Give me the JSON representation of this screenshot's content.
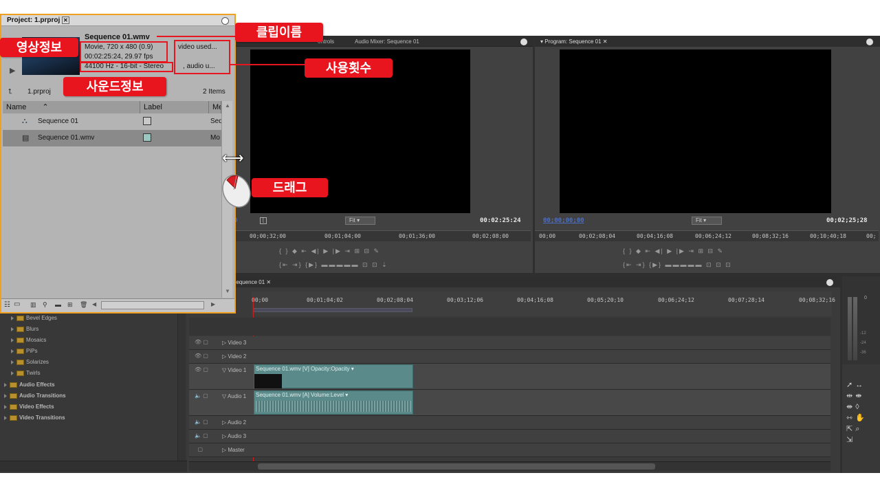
{
  "project_panel": {
    "tab_title": "Project: 1.prproj",
    "clip_name": "Sequence 01.wmv",
    "video_info_line1": "Movie, 720 x 480 (0.9)",
    "video_info_line2": "00:02:25:24, 29.97 fps",
    "audio_info": "44100 Hz - 16-bit - Stereo",
    "usage_video": "video used...",
    "usage_audio": ", audio u...",
    "bin_name": "1.prproj",
    "item_count": "2 Items",
    "columns": [
      "Name",
      "Label",
      "Me"
    ],
    "items": [
      {
        "name": "Sequence 01",
        "media": "Seq"
      },
      {
        "name": "Sequence 01.wmv",
        "media": "Mo"
      }
    ]
  },
  "source_monitor": {
    "tabs": [
      "ontrols",
      "Audio Mixer: Sequence 01"
    ],
    "timecode_left": "0",
    "fit_label": "Fit",
    "duration": "00:02:25:24",
    "ruler": [
      "00;00;32;00",
      "00;01;04;00",
      "00;01;36;00",
      "00;02;08;00"
    ]
  },
  "program_monitor": {
    "tab": "Program: Sequence 01",
    "timecode": "00;00;00;00",
    "fit_label": "Fit",
    "duration": "00;02;25;28",
    "ruler": [
      "00;00",
      "00;02;08;04",
      "00;04;16;08",
      "00;06;24;12",
      "00;08;32;16",
      "00;10;40;18",
      "00;"
    ]
  },
  "timeline": {
    "tab": "Sequence 01",
    "ruler": [
      "00;00",
      "00;01;04;02",
      "00;02;08;04",
      "00;03;12;06",
      "00;04;16;08",
      "00;05;20;10",
      "00;06;24;12",
      "00;07;28;14",
      "00;08;32;16"
    ],
    "tracks": [
      {
        "label": "Video 3"
      },
      {
        "label": "Video 2"
      },
      {
        "label": "Video 1"
      },
      {
        "label": "Audio 1"
      },
      {
        "label": "Audio 2"
      },
      {
        "label": "Audio 3"
      },
      {
        "label": "Master"
      }
    ],
    "video_clip": "Sequence 01.wmv [V]  Opacity:Opacity ▾",
    "audio_clip": "Sequence 01.wmv [A]  Volume:Level ▾"
  },
  "effects": {
    "subfolders": [
      "Bevel Edges",
      "Blurs",
      "Mosaics",
      "PiPs",
      "Solarizes",
      "Twirls"
    ],
    "folders": [
      "Audio Effects",
      "Audio Transitions",
      "Video Effects",
      "Video Transitions"
    ]
  },
  "audio_meter": {
    "label_0": "0",
    "label_12": "-12",
    "label_24": "-24",
    "label_36": "-36"
  },
  "annotations": {
    "clip_name": "클립이름",
    "video_info": "영상정보",
    "sound_info": "사운드정보",
    "usage_count": "사용횟수",
    "drag": "드래그"
  },
  "colors": {
    "accent_red": "#e8141e",
    "panel_border": "#f0a020",
    "clip_video": "#5a8a8a",
    "timecode_blue": "#4a6ec8"
  }
}
